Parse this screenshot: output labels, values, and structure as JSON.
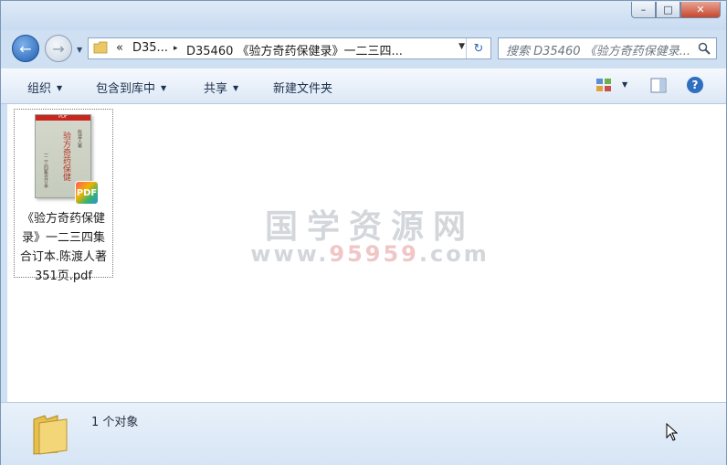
{
  "window": {
    "minimize": "–",
    "maximize": "□",
    "close": "✕"
  },
  "nav": {
    "back_glyph": "←",
    "forward_glyph": "→",
    "breadcrumb_overflow": "«",
    "breadcrumb_1": "D35...",
    "breadcrumb_sep": "▸",
    "breadcrumb_2": "D35460 《验方奇药保健录》一二三四...",
    "refresh_glyph": "↻",
    "search_placeholder": "搜索 D35460 《验方奇药保健录..."
  },
  "toolbar": {
    "organize": "组织",
    "include_in_library": "包含到库中",
    "share": "共享",
    "new_folder": "新建文件夹"
  },
  "file": {
    "name_line1": "《验方奇药保健",
    "name_line2": "录》一二三四集",
    "name_line3": "合订本.陈渡人著",
    "name_line4": "351页.pdf",
    "thumb_tag": "PDF",
    "thumb_title": "验方奇药保健",
    "thumb_author": "陈渡人著",
    "thumb_side": "一二三四集合订本",
    "badge": "PDF"
  },
  "watermark": {
    "title": "国学资源网",
    "url_prefix": "www.",
    "url_highlight": "95959",
    "url_suffix": ".com"
  },
  "status": {
    "count": "1 个对象"
  }
}
